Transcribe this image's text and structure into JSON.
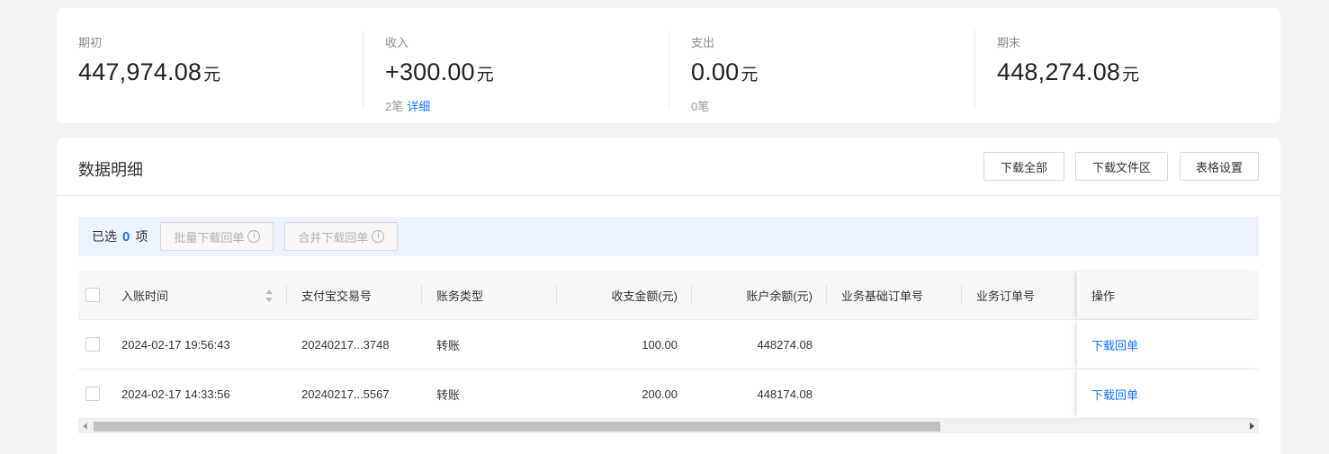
{
  "summary": {
    "items": [
      {
        "label": "期初",
        "value": "447,974.08",
        "unit": "元",
        "sub_count": "",
        "sub_link": ""
      },
      {
        "label": "收入",
        "value": "+300.00",
        "unit": "元",
        "sub_count": "2笔",
        "sub_link": "详细"
      },
      {
        "label": "支出",
        "value": "0.00",
        "unit": "元",
        "sub_count": "0笔",
        "sub_link": ""
      },
      {
        "label": "期末",
        "value": "448,274.08",
        "unit": "元",
        "sub_count": "",
        "sub_link": ""
      }
    ]
  },
  "detail": {
    "title": "数据明细",
    "buttons": {
      "download_all": "下载全部",
      "download_area": "下载文件区",
      "table_settings": "表格设置"
    }
  },
  "selection": {
    "prefix": "已选",
    "count": "0",
    "suffix": "项",
    "batch_download": "批量下载回单",
    "merge_download": "合并下载回单",
    "info_glyph": "i"
  },
  "table": {
    "columns": {
      "time": "入账时间",
      "trade_no": "支付宝交易号",
      "type": "账务类型",
      "amount": "收支金额(元)",
      "balance": "账户余额(元)",
      "base_order": "业务基础订单号",
      "order": "业务订单号",
      "action": "操作"
    },
    "rows": [
      {
        "time": "2024-02-17 19:56:43",
        "trade_no": "20240217...3748",
        "type": "转账",
        "amount": "100.00",
        "balance": "448274.08",
        "base_order": "",
        "order": "",
        "action": "下载回单"
      },
      {
        "time": "2024-02-17 14:33:56",
        "trade_no": "20240217...5567",
        "type": "转账",
        "amount": "200.00",
        "balance": "448174.08",
        "base_order": "",
        "order": "",
        "action": "下载回单"
      }
    ]
  },
  "scrollbar": {
    "position_fraction": 0.0,
    "visible_fraction": 0.72
  },
  "colors": {
    "accent": "#1677ff",
    "selection_bg": "#edf3fe",
    "page_bg": "#f4f4f4"
  }
}
